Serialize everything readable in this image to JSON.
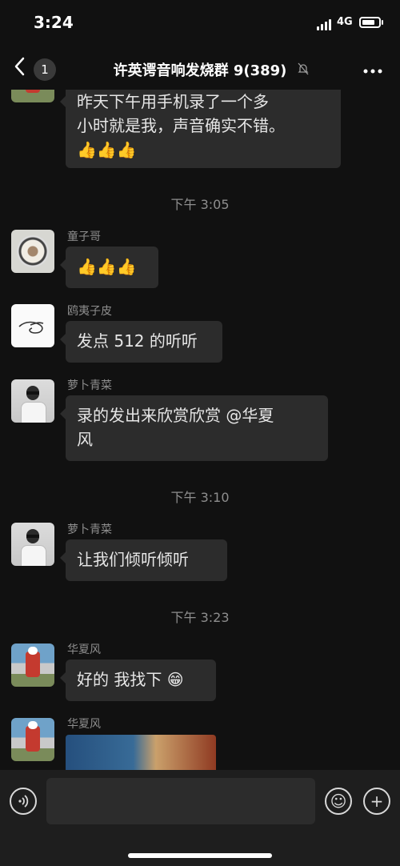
{
  "status_bar": {
    "time": "3:24",
    "network": "4G"
  },
  "nav": {
    "back_count": "1",
    "title": "许英谔音响发烧群 9(389)",
    "mute_icon": "bell-slash-icon",
    "more_icon": "more-dots-icon"
  },
  "messages": [
    {
      "sender": "",
      "lines": [
        "昨天下午用手机录了一个多",
        "小时就是我，声音确实不错。"
      ],
      "emoji": "👍👍👍"
    },
    {
      "timestamp": "下午 3:05"
    },
    {
      "sender": "童子哥",
      "emoji": "👍👍👍"
    },
    {
      "sender": "鸥夷子皮",
      "text": "发点 512 的听听"
    },
    {
      "sender": "萝卜青菜",
      "lines": [
        "录的发出来欣赏欣赏 @华夏",
        "风"
      ]
    },
    {
      "timestamp": "下午 3:10"
    },
    {
      "sender": "萝卜青菜",
      "text": "让我们倾听倾听"
    },
    {
      "timestamp": "下午 3:23"
    },
    {
      "sender": "华夏风",
      "text": "好的 我找下",
      "trailing_emoji": "😁"
    },
    {
      "sender": "华夏风",
      "image": true
    }
  ],
  "input_bar": {
    "voice_icon": "voice-icon",
    "emoji_icon": "smiley-icon",
    "add_icon": "plus-icon",
    "emoji_glyph": "☺",
    "add_glyph": "+"
  }
}
